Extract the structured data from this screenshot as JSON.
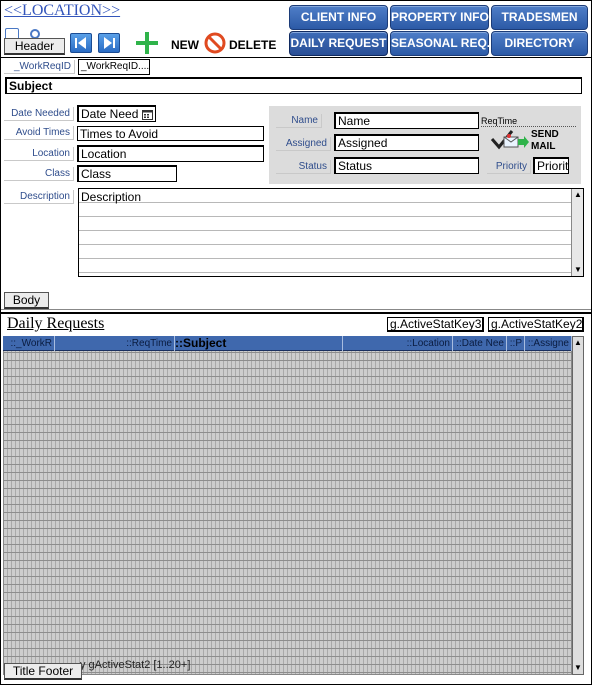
{
  "header": {
    "location_title": "<<LOCATION>>",
    "section_label": "Header",
    "new_label": "NEW",
    "delete_label": "DELETE"
  },
  "nav_buttons": [
    {
      "label": "CLIENT INFO"
    },
    {
      "label": "PROPERTY INFO"
    },
    {
      "label": "TRADESMEN"
    },
    {
      "label": "DAILY REQUEST"
    },
    {
      "label": "SEASONAL REQ."
    },
    {
      "label": "DIRECTORY"
    }
  ],
  "form": {
    "workreqid_label": "_WorkReqID",
    "workreqid_value": "_WorkReqID....",
    "subject_value": "Subject",
    "date_needed_label": "Date Needed",
    "date_needed_value": "Date Need",
    "avoid_times_label": "Avoid Times",
    "avoid_times_value": "Times to Avoid",
    "location_label": "Location",
    "location_value": "Location",
    "class_label": "Class",
    "class_value": "Class",
    "name_label": "Name",
    "name_value": "Name",
    "reqtime_value": "ReqTime",
    "assigned_label": "Assigned",
    "assigned_value": "Assigned",
    "status_label": "Status",
    "status_value": "Status",
    "priority_label": "Priority",
    "priority_value": "Priorit",
    "send_mail_label_1": "SEND",
    "send_mail_label_2": "MAIL",
    "description_label": "Description",
    "description_value": "Description",
    "body_section_label": "Body"
  },
  "list": {
    "title": "Daily Requests",
    "key3": "g.ActiveStatKey3",
    "key2": "g.ActiveStatKey2",
    "columns": [
      "::_WorkR",
      "::ReqTime",
      "::Subject",
      "::Location",
      "::Date Nee",
      "::P",
      "::Assigne"
    ],
    "footer_text": "y gActiveStat2 [1..20+]",
    "footer_section_label": "Title Footer"
  },
  "colors": {
    "nav_button": "#3a66b0",
    "header_row": "#3f68ad",
    "label_text": "#2f4d8c",
    "location_title": "#3355bb",
    "new_plus": "#2fb34a",
    "delete_icon": "#e04a20"
  }
}
